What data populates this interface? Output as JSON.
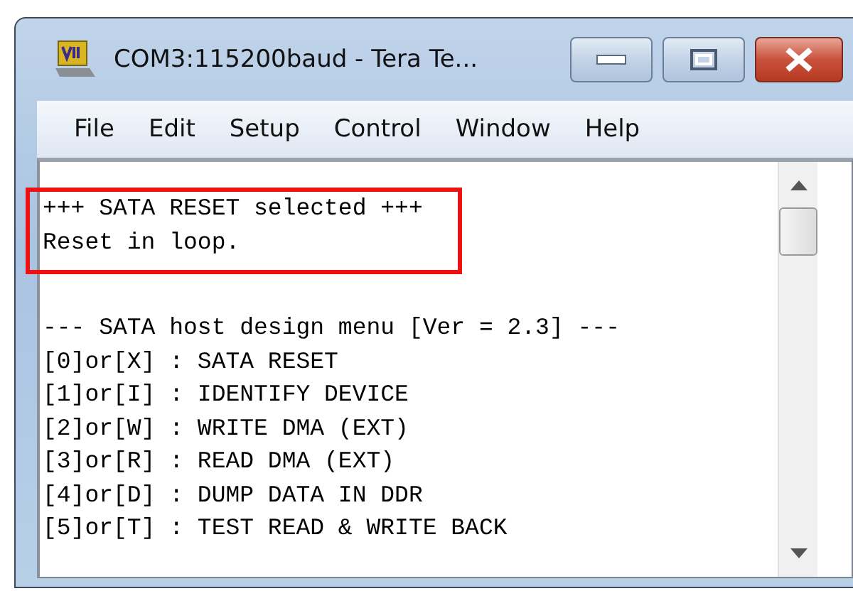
{
  "window": {
    "title": "COM3:115200baud - Tera Te..."
  },
  "menu": [
    {
      "label": "File"
    },
    {
      "label": "Edit"
    },
    {
      "label": "Setup"
    },
    {
      "label": "Control"
    },
    {
      "label": "Window"
    },
    {
      "label": "Help"
    }
  ],
  "terminal": {
    "blocks": [
      {
        "highlighted": true,
        "lines": [
          "+++ SATA RESET selected +++",
          "Reset in loop."
        ]
      },
      {
        "highlighted": false,
        "lines": [
          "--- SATA host design menu [Ver = 2.3] ---",
          "[0]or[X] : SATA RESET",
          "[1]or[I] : IDENTIFY DEVICE",
          "[2]or[W] : WRITE DMA (EXT)",
          "[3]or[R] : READ DMA (EXT)",
          "[4]or[D] : DUMP DATA IN DDR",
          "[5]or[T] : TEST READ & WRITE BACK"
        ]
      }
    ]
  }
}
